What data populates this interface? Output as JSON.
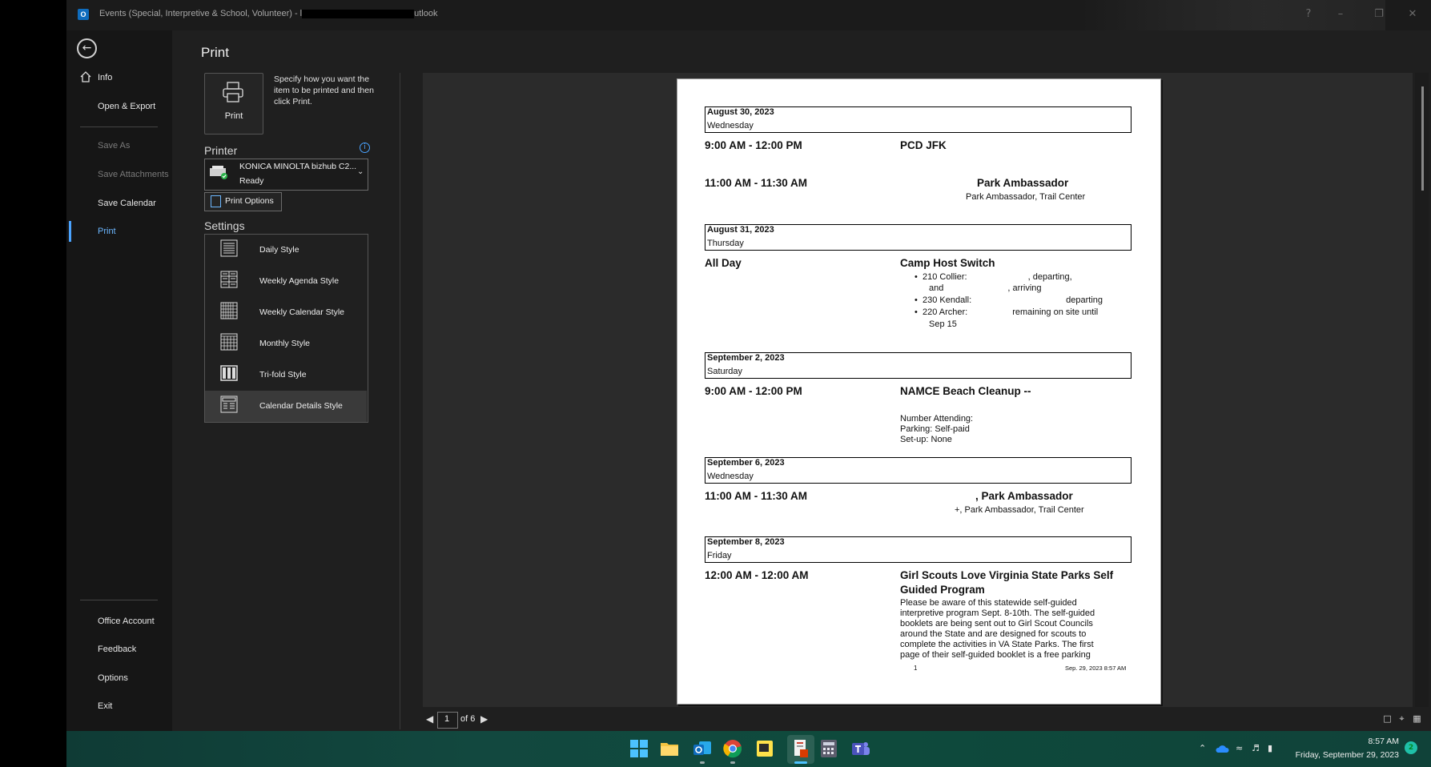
{
  "window": {
    "title_prefix": "Events (Special, Interpretive & School, Volunteer) - l",
    "title_suffix": "utlook",
    "app_icon": "O"
  },
  "sidebar": {
    "items": [
      {
        "label": "Info",
        "state": "normal"
      },
      {
        "label": "Open & Export",
        "state": "normal"
      },
      {
        "label": "Save As",
        "state": "disabled"
      },
      {
        "label": "Save Attachments",
        "state": "disabled"
      },
      {
        "label": "Save Calendar",
        "state": "normal"
      },
      {
        "label": "Print",
        "state": "selected"
      }
    ],
    "bottom_items": [
      "Office Account",
      "Feedback",
      "Options",
      "Exit"
    ]
  },
  "print_panel": {
    "heading": "Print",
    "print_button_label": "Print",
    "description": "Specify how you want the item to be printed and then click Print.",
    "printer_heading": "Printer",
    "printer_name": "KONICA MINOLTA bizhub C2...",
    "printer_status": "Ready",
    "print_options_label": "Print Options",
    "settings_heading": "Settings",
    "styles": [
      {
        "label": "Daily Style",
        "selected": false
      },
      {
        "label": "Weekly Agenda Style",
        "selected": false
      },
      {
        "label": "Weekly Calendar Style",
        "selected": false
      },
      {
        "label": "Monthly Style",
        "selected": false
      },
      {
        "label": "Tri-fold Style",
        "selected": false
      },
      {
        "label": "Calendar Details Style",
        "selected": true
      }
    ]
  },
  "preview": {
    "days": [
      {
        "date": "August 30, 2023",
        "weekday": "Wednesday"
      },
      {
        "date": "August 31, 2023",
        "weekday": "Thursday"
      },
      {
        "date": "September 2, 2023",
        "weekday": "Saturday"
      },
      {
        "date": "September 6, 2023",
        "weekday": "Wednesday"
      },
      {
        "date": "September 8, 2023",
        "weekday": "Friday"
      }
    ],
    "events": {
      "e1": {
        "time": "9:00 AM - 12:00 PM",
        "title": "PCD JFK"
      },
      "e2": {
        "time": "11:00 AM - 11:30 AM",
        "title_visible": "Park Ambassador",
        "sub_visible": "Park Ambassador, Trail Center"
      },
      "e3": {
        "time": "All Day",
        "title": "Camp Host Switch",
        "bullets": [
          "210 Collier:",
          ", departing,",
          "and",
          ", arriving",
          "230 Kendall:",
          "departing",
          "220 Archer:",
          "remaining on site until",
          "Sep 15"
        ]
      },
      "e4": {
        "time": "9:00 AM - 12:00 PM",
        "title_visible": "NAMCE Beach Cleanup --",
        "details": [
          "Number Attending:",
          "Parking: Self-paid",
          "Set-up: None"
        ]
      },
      "e5": {
        "time": "11:00 AM - 11:30 AM",
        "title_visible": ", Park Ambassador",
        "sub_visible": "+, Park Ambassador, Trail Center"
      },
      "e6": {
        "time": "12:00 AM - 12:00 AM",
        "title_line1": "Girl Scouts Love Virginia State Parks Self",
        "title_line2": "Guided Program",
        "body": [
          "Please be aware of this statewide self-guided",
          "interpretive program Sept. 8-10th. The self-guided",
          "booklets are being sent out to Girl Scout Councils",
          "around the State and are designed for scouts to",
          "complete the activities in VA State Parks. The first",
          "page of their self-guided booklet is a free parking"
        ]
      }
    },
    "footer_page": "1",
    "footer_timestamp": "Sep. 29, 2023 8:57 AM"
  },
  "pager": {
    "current_page": "1",
    "of_label": "of 6"
  },
  "taskbar": {
    "time": "8:57 AM",
    "date": "Friday, September 29, 2023",
    "notification_count": "2"
  },
  "colors": {
    "accent": "#4aa3ff",
    "taskbar_teal": "#12483f",
    "background": "#1f1f1f"
  }
}
